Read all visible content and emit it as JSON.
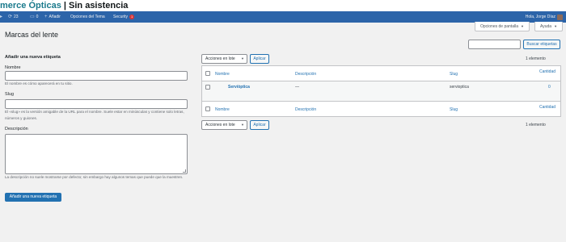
{
  "brand": {
    "part1": "merce Ópticas",
    "separator": " | ",
    "part2": "Sin asistencia"
  },
  "adminbar": {
    "updates_count": "23",
    "comments_count": "0",
    "add_label": "Añadir",
    "theme_options_label": "Opciones del Tema",
    "security_label": "Security",
    "security_badge": "1",
    "greeting": "Hola, Jorge Díaz"
  },
  "screen_meta": {
    "options_label": "Opciones de pantalla",
    "help_label": "Ayuda"
  },
  "page": {
    "title": "Marcas del lente"
  },
  "search": {
    "value": "",
    "button_label": "Buscar etiquetas"
  },
  "form": {
    "title": "Añadir una nueva etiqueta",
    "name_label": "Nombre",
    "name_value": "",
    "name_help": "El nombre es cómo aparecerá en tu sitio.",
    "slug_label": "Slug",
    "slug_value": "",
    "slug_help": "El «slug» es la versión amigable de la URL para el nombre. Suele estar en minúsculas y contiene solo letras, números y guiones.",
    "description_label": "Descripción",
    "description_value": "",
    "description_help": "La descripción no suele mostrarse por defecto; sin embargo hay algunos temas que puede que la muestren.",
    "submit_label": "Añadir una nueva etiqueta"
  },
  "bulk": {
    "select_label": "Acciones en lote",
    "apply_label": "Aplicar",
    "count": "1 elemento"
  },
  "table": {
    "columns": {
      "name": "Nombre",
      "description": "Descripción",
      "slug": "Slug",
      "count": "Cantidad"
    },
    "rows": [
      {
        "name": "Serviòptica",
        "description": "—",
        "slug": "servioptica",
        "count": "0"
      }
    ]
  },
  "colors": {
    "adminbar": "#2c64a9",
    "primary": "#2271b1",
    "background": "#f1f1f1",
    "brand_teal": "#1a7a8c"
  },
  "icons": {
    "updates": "refresh-icon",
    "comments": "comment-icon",
    "add": "plus-icon",
    "caret": "caret-down-icon"
  }
}
